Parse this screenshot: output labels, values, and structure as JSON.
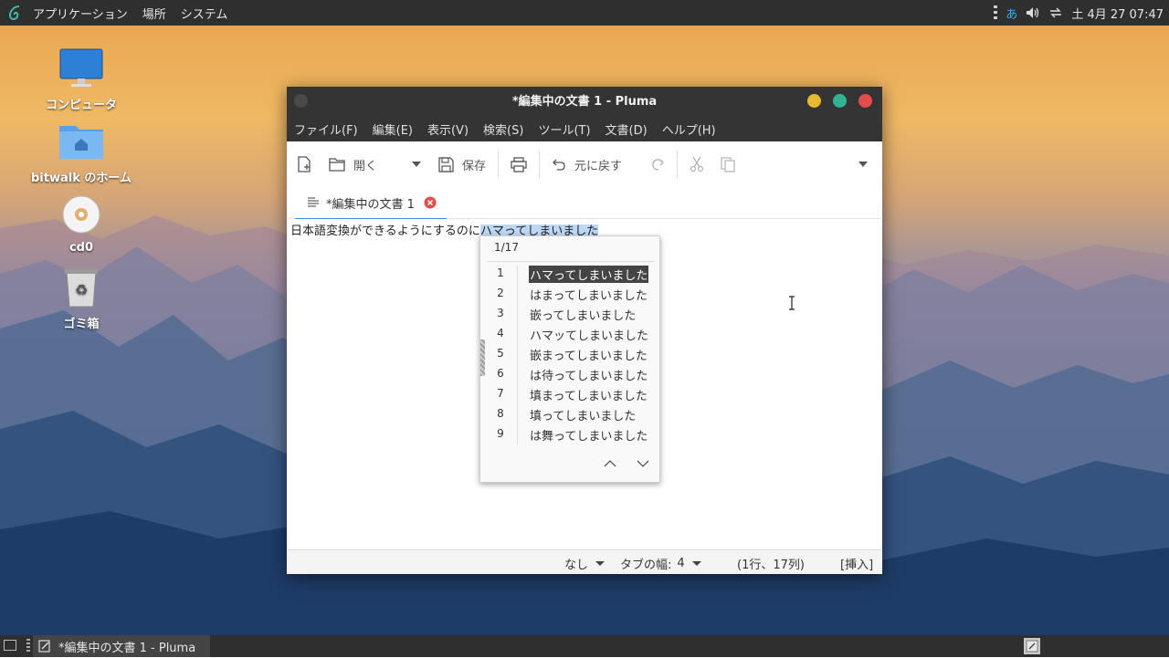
{
  "top_panel": {
    "menus": [
      "アプリケーション",
      "場所",
      "システム"
    ],
    "tray": {
      "ime": "あ",
      "clock": "土 4月 27 07:47"
    }
  },
  "desktop": {
    "icons": [
      {
        "label": "コンピュータ",
        "icon": "monitor-icon"
      },
      {
        "label": "bitwalk のホーム",
        "icon": "home-folder-icon"
      },
      {
        "label": "cd0",
        "icon": "disc-icon"
      },
      {
        "label": "ゴミ箱",
        "icon": "trash-icon"
      }
    ]
  },
  "window": {
    "title": "*編集中の文書 1 - Pluma",
    "menus": [
      "ファイル(F)",
      "編集(E)",
      "表示(V)",
      "検索(S)",
      "ツール(T)",
      "文書(D)",
      "ヘルプ(H)"
    ],
    "toolbar": {
      "open_label": "開く",
      "save_label": "保存",
      "undo_label": "元に戻す"
    },
    "tab_label": "*編集中の文書 1",
    "editor": {
      "text": "日本語変換ができるようにするのに",
      "preedit": "ハマってしまいました"
    },
    "status": {
      "highlight_mode": "なし",
      "tab_width_label": "タブの幅:",
      "tab_width_value": "4",
      "position": "(1行、17列)",
      "insert_mode": "[挿入]"
    }
  },
  "candidates": {
    "page": "1/17",
    "selected_index": 0,
    "items": [
      {
        "num": "1",
        "text": "ハマってしまいました"
      },
      {
        "num": "2",
        "text": "はまってしまいました"
      },
      {
        "num": "3",
        "text": "嵌ってしまいました"
      },
      {
        "num": "4",
        "text": "ハマッてしまいました"
      },
      {
        "num": "5",
        "text": "嵌まってしまいました"
      },
      {
        "num": "6",
        "text": "は待ってしまいました"
      },
      {
        "num": "7",
        "text": "填まってしまいました"
      },
      {
        "num": "8",
        "text": "填ってしまいました"
      },
      {
        "num": "9",
        "text": "は舞ってしまいました"
      }
    ]
  },
  "taskbar": {
    "task_label": "*編集中の文書 1 - Pluma"
  },
  "colors": {
    "accent": "#3a8de0",
    "close": "#e54b4b",
    "minimize": "#e8b92e",
    "maximize": "#2fb391",
    "panel": "#2f2f2f"
  }
}
